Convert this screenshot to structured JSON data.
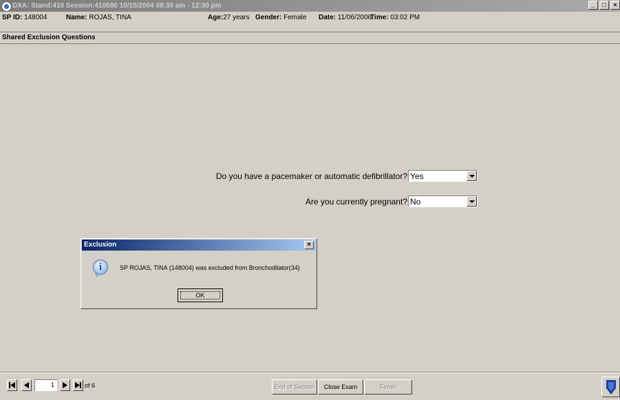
{
  "window": {
    "title": "DXA: Stand:410 Session:410580 10/15/2004 08:30 am - 12:30 pm",
    "minimize": "_",
    "maximize": "□",
    "close": "×"
  },
  "info": {
    "sp_id_label": "SP ID:",
    "sp_id": "148004",
    "name_label": "Name:",
    "name": "ROJAS, TINA",
    "age_label": "Age:",
    "age": "27 years",
    "gender_label": "Gender:",
    "gender": "Female",
    "date_label": "Date:",
    "date": "11/06/2006",
    "time_label": "Time:",
    "time": "03:02 PM"
  },
  "section": {
    "title": "Shared Exclusion Questions"
  },
  "questions": [
    {
      "label": "Do you have a pacemaker or automatic defibrillator?",
      "value": "Yes"
    },
    {
      "label": "Are you currently pregnant?",
      "value": "No"
    }
  ],
  "dialog": {
    "title": "Exclusion",
    "close": "×",
    "icon": "info-icon",
    "message": "SP ROJAS, TINA  (148004) was excluded from Bronchodilator(34)",
    "ok_label": "OK"
  },
  "footer": {
    "page_current": "1",
    "page_total_text": "of 6",
    "end_section_label": "End of Section",
    "close_exam_label": "Close Exam",
    "finish_label": "Finish"
  }
}
